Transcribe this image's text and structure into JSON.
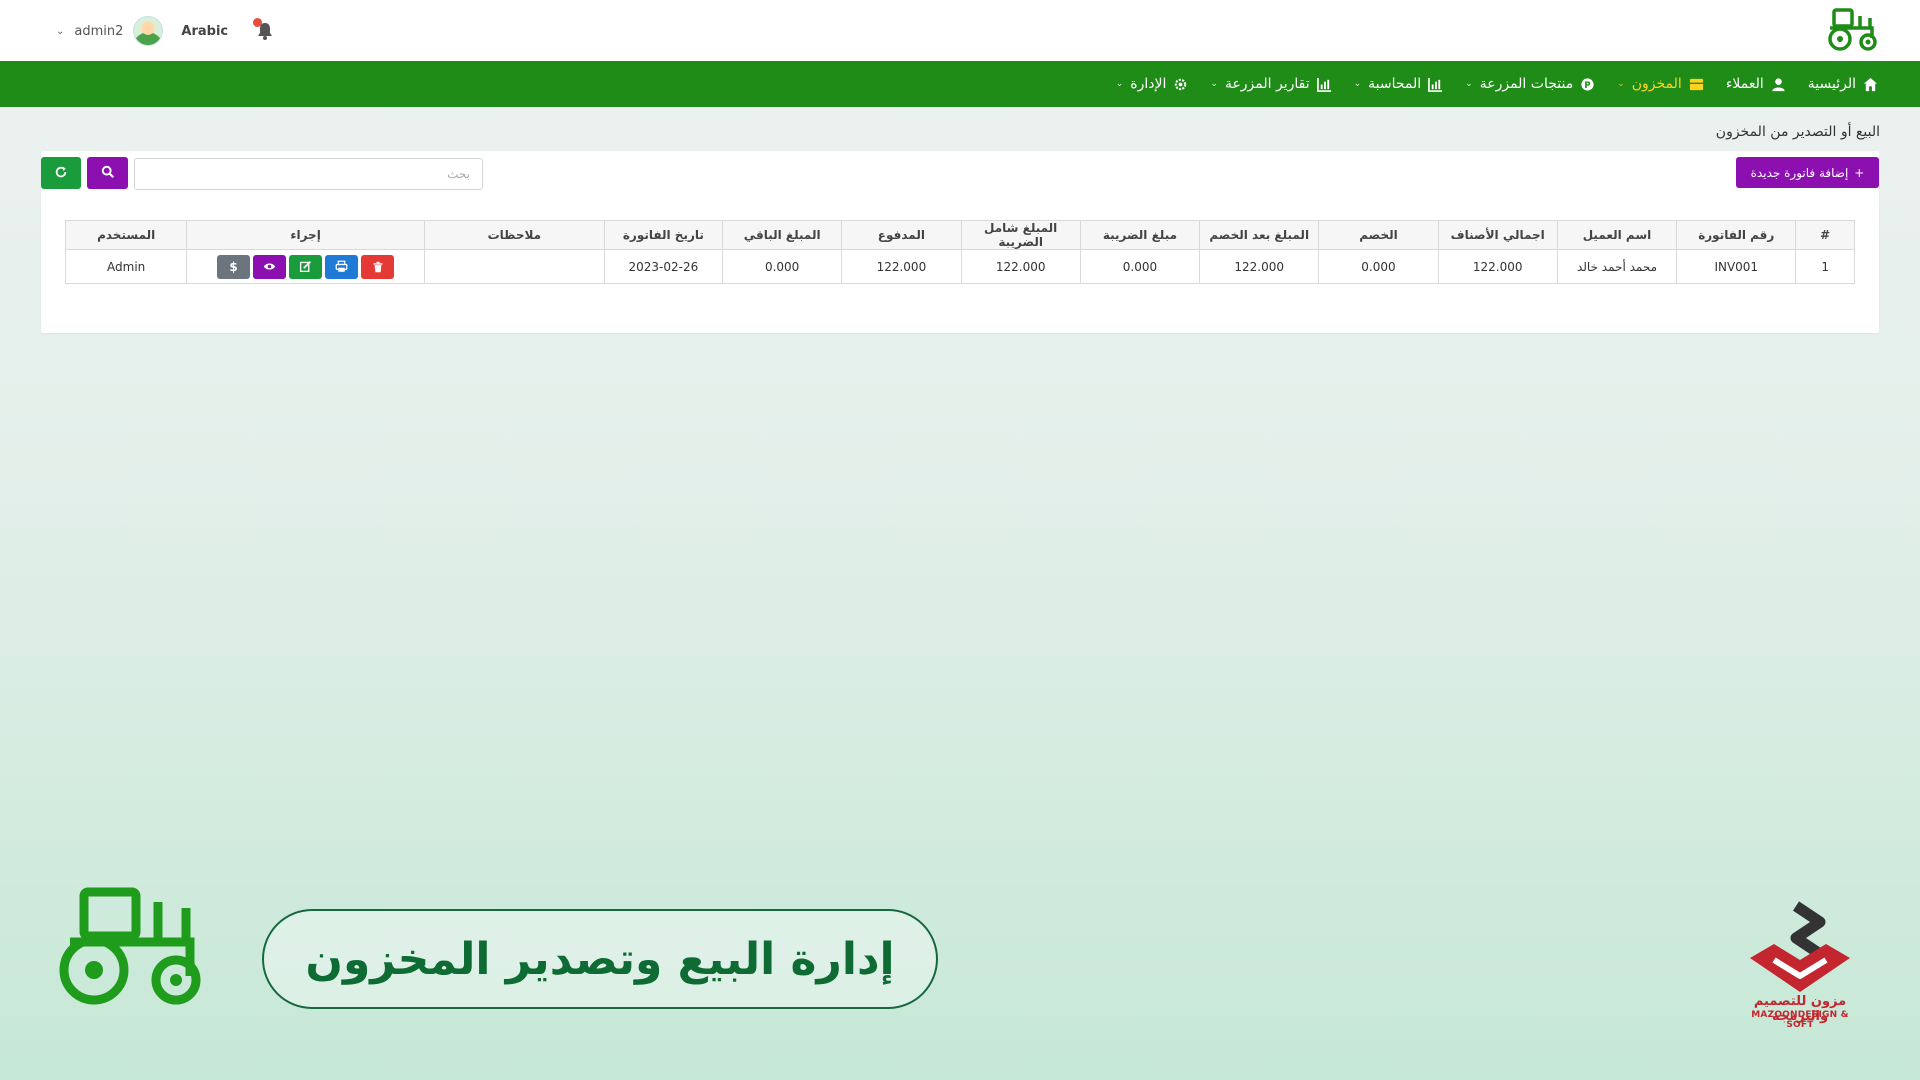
{
  "header": {
    "user_name": "admin2",
    "language": "Arabic",
    "notification_count": "0"
  },
  "nav": {
    "items": [
      {
        "label": "الرئيسية",
        "icon": "home-icon"
      },
      {
        "label": "العملاء",
        "icon": "user-icon"
      },
      {
        "label": "المخزون",
        "icon": "box-icon",
        "active": true
      },
      {
        "label": "منتجات المزرعة",
        "icon": "product-icon"
      },
      {
        "label": "المحاسبة",
        "icon": "chart-icon"
      },
      {
        "label": "تقارير المزرعة",
        "icon": "chart-icon"
      },
      {
        "label": "الإدارة",
        "icon": "gear-icon"
      }
    ]
  },
  "page": {
    "title": "البيع أو التصدير من المخزون",
    "add_button": "إضافة فاتورة جديدة",
    "search_placeholder": "بحث"
  },
  "table": {
    "headers": [
      "#",
      "رقم الفاتورة",
      "اسم العميل",
      "اجمالي الأصناف",
      "الخصم",
      "المبلغ بعد الخصم",
      "مبلغ الضريبة",
      "المبلغ شامل الضريبة",
      "المدفوع",
      "المبلغ الباقي",
      "تاريخ الفاتورة",
      "ملاحظات",
      "إجراء",
      "المستخدم"
    ],
    "rows": [
      {
        "index": "1",
        "invoice": "INV001",
        "customer": "محمد أحمد خالد",
        "total_items": "122.000",
        "discount": "0.000",
        "after_discount": "122.000",
        "tax": "0.000",
        "with_tax": "122.000",
        "paid": "122.000",
        "remaining": "0.000",
        "date": "2023-02-26",
        "notes": "",
        "user": "Admin"
      }
    ]
  },
  "banner": {
    "text": "إدارة البيع وتصدير المخزون"
  },
  "brand": {
    "arabic": "مزون للتصميم والبرمجة",
    "english": "MAZOONDESIGN & SOFT"
  },
  "colors": {
    "nav_green": "#1f8c17",
    "nav_active": "#ffd21f",
    "purple": "#8c0fb0",
    "green_button": "#1a9c3c",
    "banner_green": "#0f6b34",
    "brand_red": "#c3262e"
  }
}
